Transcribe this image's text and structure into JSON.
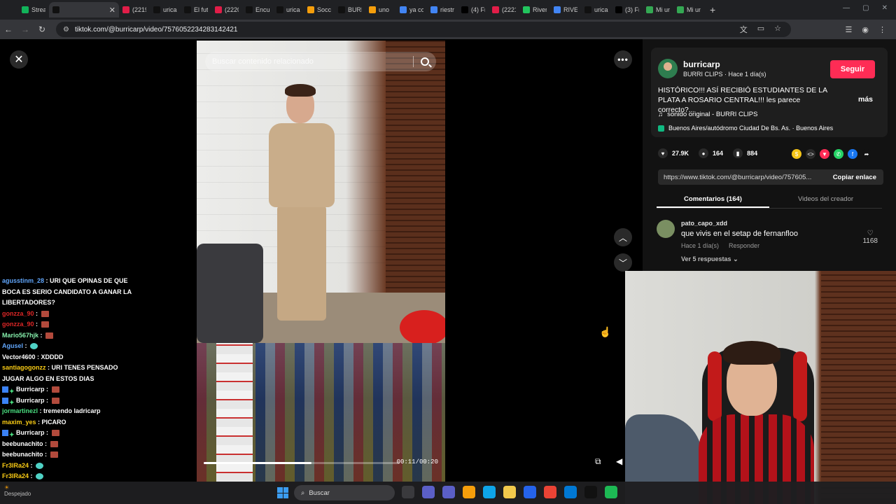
{
  "browser": {
    "tabs": [
      {
        "label": "Stream",
        "color": "#12b35a",
        "active": false
      },
      {
        "label": "",
        "color": "#111111",
        "active": true
      },
      {
        "label": "(2219",
        "color": "#e11d48",
        "active": false
      },
      {
        "label": "uricar",
        "color": "#111111",
        "active": false
      },
      {
        "label": "El futu",
        "color": "#111111",
        "active": false
      },
      {
        "label": "(2220",
        "color": "#e11d48",
        "active": false
      },
      {
        "label": "Encue",
        "color": "#111111",
        "active": false
      },
      {
        "label": "uricar",
        "color": "#111111",
        "active": false
      },
      {
        "label": "Socce",
        "color": "#f59e0b",
        "active": false
      },
      {
        "label": "BURR",
        "color": "#111111",
        "active": false
      },
      {
        "label": "uno",
        "color": "#f59e0b",
        "active": false
      },
      {
        "label": "ya co",
        "color": "#4285f4",
        "active": false
      },
      {
        "label": "riestra",
        "color": "#4285f4",
        "active": false
      },
      {
        "label": "(4) Fr",
        "color": "#000000",
        "active": false
      },
      {
        "label": "(2221",
        "color": "#e11d48",
        "active": false
      },
      {
        "label": "River",
        "color": "#22c55e",
        "active": false
      },
      {
        "label": "RIVER",
        "color": "#4285f4",
        "active": false
      },
      {
        "label": "uricar",
        "color": "#111111",
        "active": false
      },
      {
        "label": "(3) Fr",
        "color": "#000000",
        "active": false
      },
      {
        "label": "Mi un",
        "color": "#34a853",
        "active": false
      },
      {
        "label": "Mi un",
        "color": "#34a853",
        "active": false
      }
    ],
    "url": "tiktok.com/@burricarp/video/7576052234283142421"
  },
  "video": {
    "search_placeholder": "Buscar contenido relacionado",
    "timecode": "00:11/00:20",
    "progress": 0.55
  },
  "chat": [
    {
      "user": "agusstinm_28",
      "color": "#60a5fa",
      "text": "URI QUE OPINAS DE QUE BOCA ES SERIO CANDIDATO A GANAR LA LIBERTADORES?",
      "emote": "",
      "badges": false
    },
    {
      "user": "gonzza_90",
      "color": "#dc2626",
      "text": "",
      "emote": "brick",
      "badges": false
    },
    {
      "user": "gonzza_90",
      "color": "#dc2626",
      "text": "",
      "emote": "brick",
      "badges": false
    },
    {
      "user": "Mario567hjk",
      "color": "#86efac",
      "text": "",
      "emote": "brick",
      "badges": false
    },
    {
      "user": "Agusel",
      "color": "#60a5fa",
      "text": "",
      "emote": "cyan",
      "badges": false
    },
    {
      "user": "Vector4600",
      "color": "#ffffff",
      "text": "XDDDD",
      "emote": "",
      "badges": false
    },
    {
      "user": "santiagogonzz",
      "color": "#facc15",
      "text": "URI TENES PENSADO JUGAR ALGO EN ESTOS DIAS",
      "emote": "",
      "badges": false
    },
    {
      "user": "Burricarp",
      "color": "#ffffff",
      "text": "",
      "emote": "brick",
      "badges": true
    },
    {
      "user": "Burricarp",
      "color": "#ffffff",
      "text": "",
      "emote": "brick",
      "badges": true
    },
    {
      "user": "jormartinezl",
      "color": "#4ade80",
      "text": "tremendo ladricarp",
      "emote": "",
      "badges": false
    },
    {
      "user": "maxim_yes",
      "color": "#facc15",
      "text": "PICARO",
      "emote": "",
      "badges": false
    },
    {
      "user": "Burricarp",
      "color": "#ffffff",
      "text": "",
      "emote": "brick",
      "badges": true
    },
    {
      "user": "beebunachito",
      "color": "#ffffff",
      "text": "",
      "emote": "brick",
      "badges": false
    },
    {
      "user": "beebunachito",
      "color": "#ffffff",
      "text": "",
      "emote": "brick",
      "badges": false
    },
    {
      "user": "Fr3lRa24",
      "color": "#facc15",
      "text": "",
      "emote": "cyan",
      "badges": false
    },
    {
      "user": "Fr3lRa24",
      "color": "#facc15",
      "text": "",
      "emote": "cyan",
      "badges": false
    }
  ],
  "panel": {
    "author": "burricarp",
    "subline": "BURRI CLIPS · Hace 1 día(s)",
    "follow_label": "Seguir",
    "description": "HISTÓRICO!!! ASÍ RECIBIÓ ESTUDIANTES DE LA PLATA A ROSARIO CENTRAL!!! les parece correcto?...",
    "more_label": "más",
    "sound": "sonido original - BURRI CLIPS",
    "location": "Buenos Aires/autódromo Ciudad De Bs. As. · Buenos Aires",
    "likes": "27.9K",
    "comments": "164",
    "saves": "884",
    "share_colors": [
      "#f5c518",
      "#2a2a2a",
      "#fe2c55",
      "#25d366",
      "#1877f2",
      "#121212"
    ],
    "link": "https://www.tiktok.com/@burricarp/video/757605...",
    "copy_label": "Copiar enlace",
    "tab_comments": "Comentarios (164)",
    "tab_creator": "Videos del creador",
    "comment": {
      "user": "pato_capo_xdd",
      "text": "que vivis en el setap de fernanfloo",
      "time": "Hace 1 día(s)",
      "reply_label": "Responder",
      "replies": "Ver 5 respuestas",
      "likes": "1168"
    }
  },
  "taskbar": {
    "weather_label": "Despejado",
    "search_placeholder": "Buscar",
    "app_colors": [
      "#3a3a3d",
      "#5b5fc7",
      "#5b5fc7",
      "#f59e0b",
      "#0ea5e9",
      "#f2c94c",
      "#2563eb",
      "#ea4335",
      "#0078d4",
      "#111111",
      "#1db954"
    ]
  }
}
